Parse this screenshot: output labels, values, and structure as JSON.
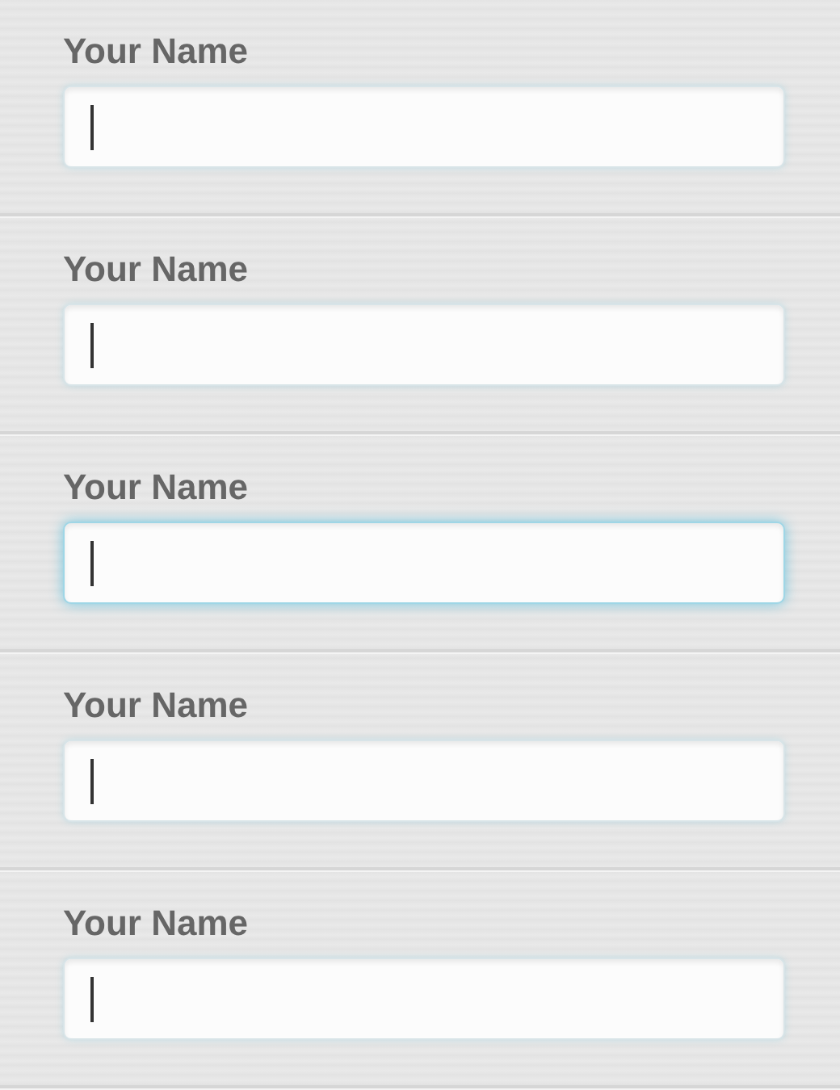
{
  "fields": [
    {
      "label": "Your Name",
      "focused": false
    },
    {
      "label": "Your Name",
      "focused": false
    },
    {
      "label": "Your Name",
      "focused": true
    },
    {
      "label": "Your Name",
      "focused": false
    },
    {
      "label": "Your Name",
      "focused": false
    }
  ]
}
